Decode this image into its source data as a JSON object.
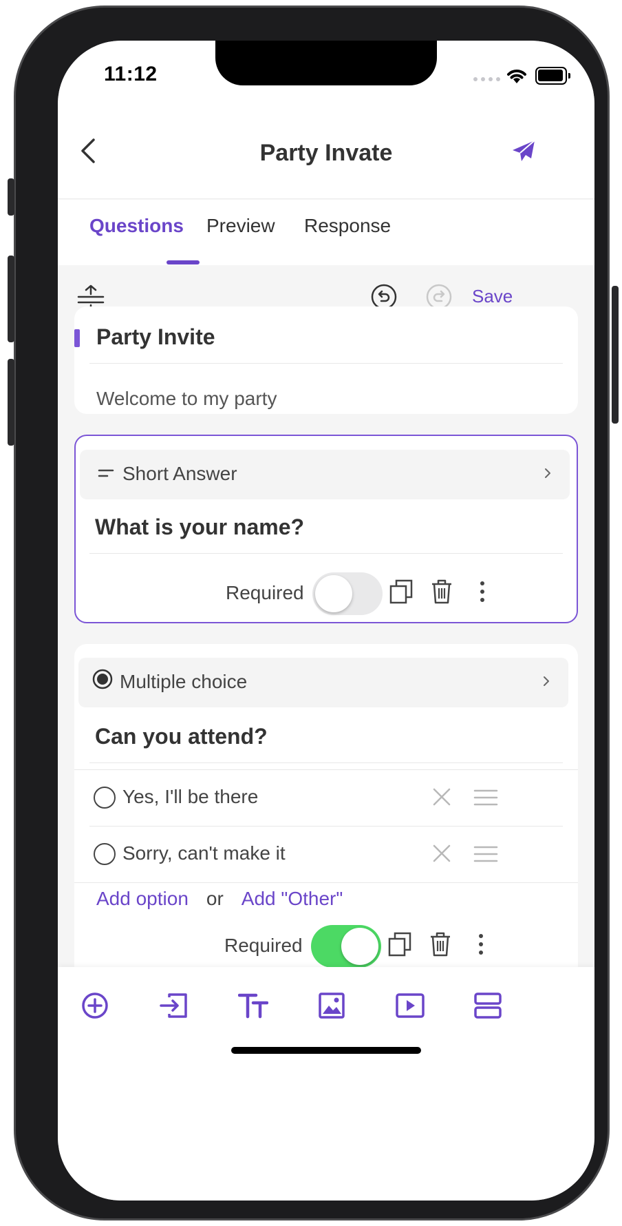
{
  "status_bar": {
    "time": "11:12"
  },
  "header": {
    "title": "Party Invate"
  },
  "tabs": [
    {
      "label": "Questions",
      "active": true
    },
    {
      "label": "Preview",
      "active": false
    },
    {
      "label": "Response",
      "active": false
    }
  ],
  "toolbar": {
    "save_label": "Save"
  },
  "form": {
    "title": "Party Invite",
    "description": "Welcome to my party"
  },
  "questions": [
    {
      "type_label": "Short Answer",
      "type_icon": "short-answer-icon",
      "question": "What is your name?",
      "required_label": "Required",
      "required": false
    },
    {
      "type_label": "Multiple choice",
      "type_icon": "radio-selected-icon",
      "question": "Can you attend?",
      "options": [
        "Yes,  I'll be there",
        "Sorry, can't make it"
      ],
      "add_option": "Add option",
      "or": "or",
      "add_other": "Add \"Other\"",
      "required_label": "Required",
      "required": true
    }
  ],
  "colors": {
    "accent": "#6a45c9",
    "toggle_on": "#4cd964",
    "toggle_off": "#e9e9ea",
    "background": "#f5f5f5"
  }
}
